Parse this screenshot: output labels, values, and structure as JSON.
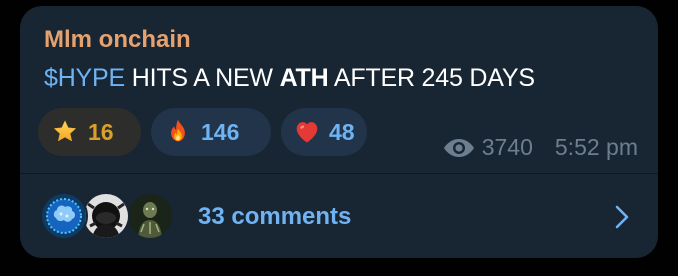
{
  "post": {
    "author": "Mlm onchain",
    "message": {
      "cashtag": "$HYPE",
      "part1": " HITS A NEW ",
      "bold": "ATH",
      "part2": " AFTER 245 DAYS"
    },
    "reactions": [
      {
        "emoji": "star",
        "count": "16"
      },
      {
        "emoji": "fire",
        "count": "146"
      },
      {
        "emoji": "heart",
        "count": "48"
      }
    ],
    "views": "3740",
    "time": "5:52 pm"
  },
  "comments": {
    "label": "33 comments",
    "avatar_count": 3
  },
  "colors": {
    "bubble": "#182533",
    "author": "#e5a26e",
    "accent": "#6fb3f3",
    "star_count": "#d9a12a",
    "meta": "#6d7f8f"
  },
  "icons": [
    "star-icon",
    "fire-icon",
    "heart-icon",
    "eye-icon",
    "chevron-right-icon"
  ]
}
